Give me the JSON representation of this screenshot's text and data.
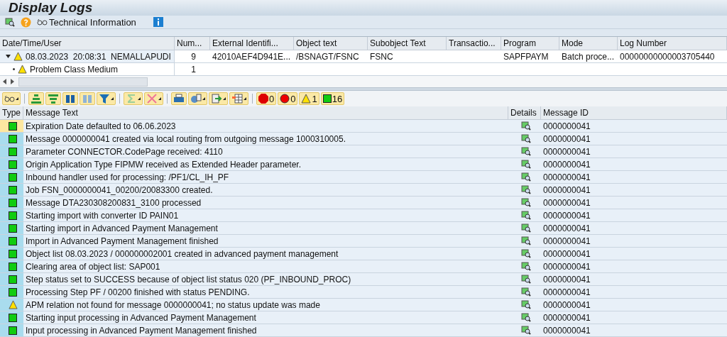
{
  "window": {
    "title": "Display Logs"
  },
  "toolbar": {
    "technical_information": "Technical Information"
  },
  "log_table": {
    "columns": [
      "Date/Time/User",
      "Num...",
      "External Identifi...",
      "Object text",
      "Subobject Text",
      "Transactio...",
      "Program",
      "Mode",
      "Log Number"
    ],
    "rows": [
      {
        "expanded": true,
        "cells": [
          "08.03.2023  20:08:31  NEMALLAPUDI",
          "9",
          "42010AEF4D941E...",
          "/BSNAGT/FSNC",
          "FSNC",
          "",
          "SAPFPAYM",
          "Batch proce...",
          "00000000000003705440"
        ],
        "children": [
          {
            "cells": [
              "Problem Class Medium",
              "1",
              "",
              "",
              "",
              "",
              "",
              "",
              ""
            ]
          }
        ]
      }
    ]
  },
  "counters": [
    {
      "kind": "stop",
      "count": "0"
    },
    {
      "kind": "error",
      "count": "0"
    },
    {
      "kind": "warning",
      "count": "1"
    },
    {
      "kind": "success",
      "count": "16"
    }
  ],
  "messages": {
    "columns": [
      "Type",
      "Message Text",
      "Details",
      "Message ID"
    ],
    "rows": [
      {
        "kind": "success",
        "selected": true,
        "text": "Expiration Date defaulted to 06.06.2023",
        "id": "0000000041"
      },
      {
        "kind": "success",
        "selected": false,
        "text": "Message 0000000041 created via local routing from outgoing message 1000310005.",
        "id": "0000000041"
      },
      {
        "kind": "success",
        "selected": false,
        "text": "Parameter CONNECTOR.CodePage received: 4110",
        "id": "0000000041"
      },
      {
        "kind": "success",
        "selected": false,
        "text": "Origin Application Type FIPMW received as Extended Header parameter.",
        "id": "0000000041"
      },
      {
        "kind": "success",
        "selected": false,
        "text": "Inbound handler used for processing: /PF1/CL_IH_PF",
        "id": "0000000041"
      },
      {
        "kind": "success",
        "selected": false,
        "text": "Job FSN_0000000041_00200/20083300 created.",
        "id": "0000000041"
      },
      {
        "kind": "success",
        "selected": false,
        "text": "Message DTA230308200831_3100 processed",
        "id": "0000000041"
      },
      {
        "kind": "success",
        "selected": false,
        "text": "Starting import with converter ID PAIN01",
        "id": "0000000041"
      },
      {
        "kind": "success",
        "selected": false,
        "text": "Starting import in Advanced Payment Management",
        "id": "0000000041"
      },
      {
        "kind": "success",
        "selected": false,
        "text": "Import in Advanced Payment Management finished",
        "id": "0000000041"
      },
      {
        "kind": "success",
        "selected": false,
        "text": "Object list 08.03.2023 / 000000002001 created in advanced payment management",
        "id": "0000000041"
      },
      {
        "kind": "success",
        "selected": false,
        "text": "Clearing area of object list: SAP001",
        "id": "0000000041"
      },
      {
        "kind": "success",
        "selected": false,
        "text": "Step status set to SUCCESS because of object list status 020 (PF_INBOUND_PROC)",
        "id": "0000000041"
      },
      {
        "kind": "success",
        "selected": false,
        "text": "Processing Step PF / 00200 finished with status PENDING.",
        "id": "0000000041"
      },
      {
        "kind": "warning",
        "selected": false,
        "text": "APM relation not found for message 0000000041; no status update was made",
        "id": "0000000041"
      },
      {
        "kind": "success",
        "selected": false,
        "text": "Starting input processing in Advanced Payment Management",
        "id": "0000000041"
      },
      {
        "kind": "success",
        "selected": false,
        "text": "Input processing in Advanced Payment Management finished",
        "id": "0000000041"
      }
    ]
  }
}
